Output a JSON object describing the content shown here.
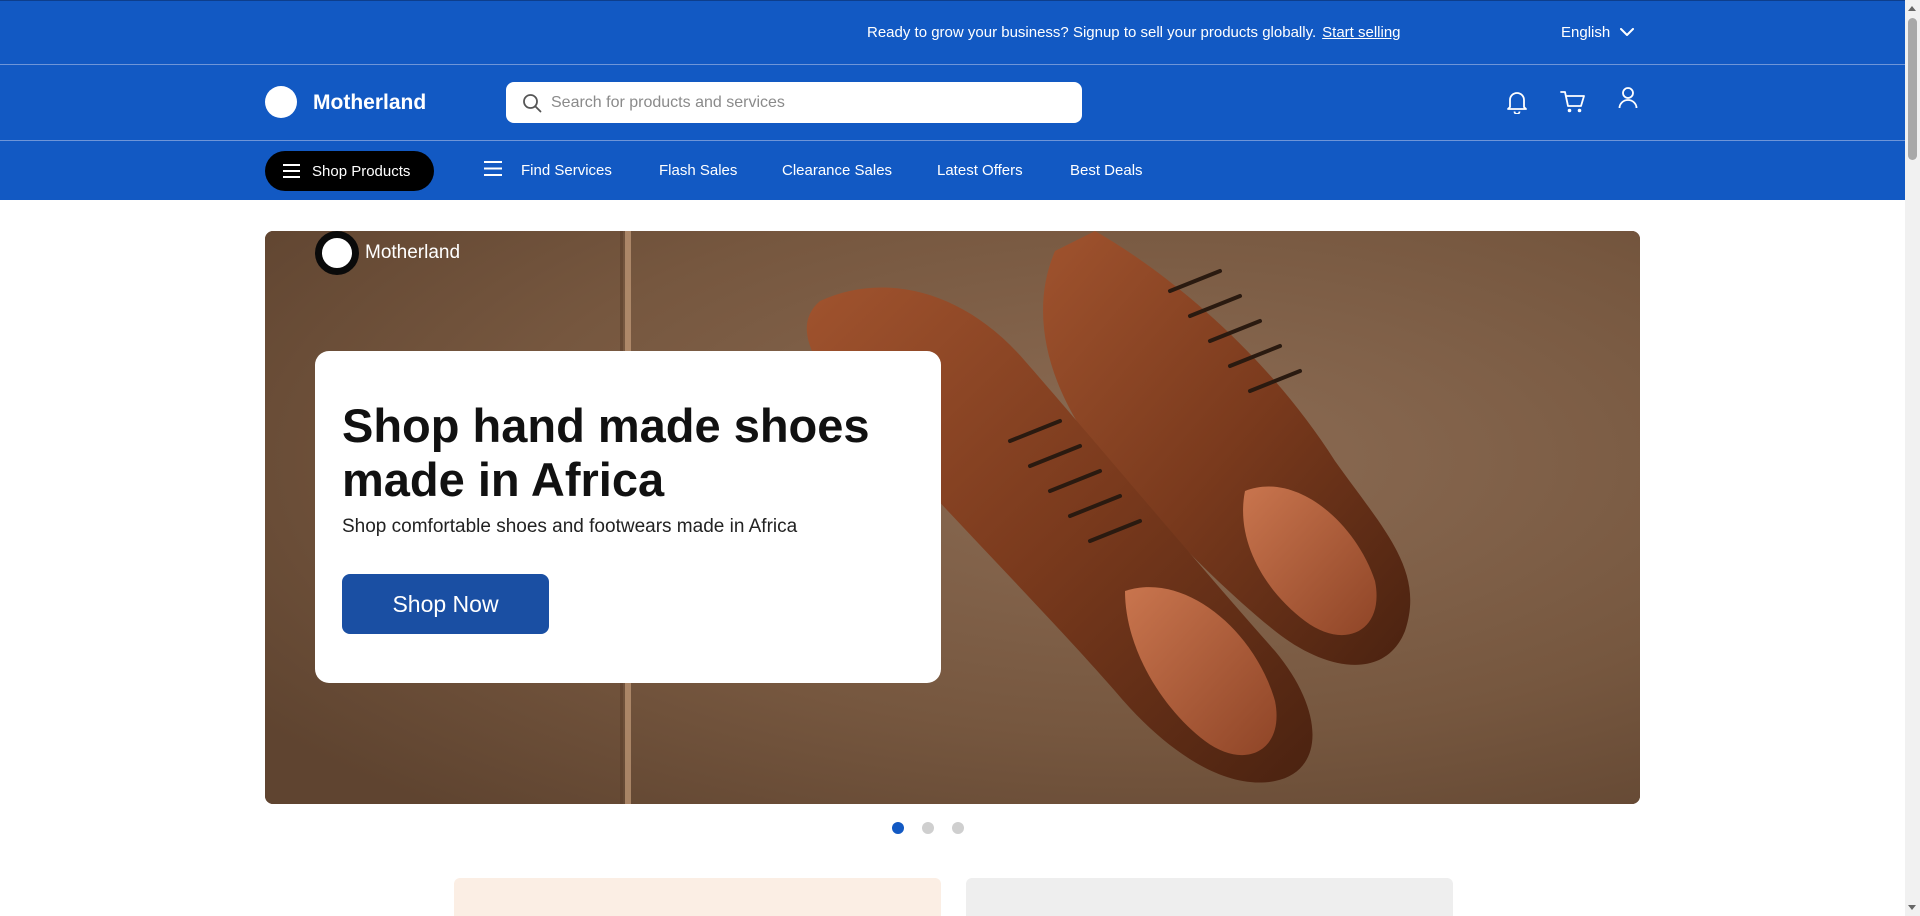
{
  "topbar": {
    "announcement": "Ready to grow your business? Signup to sell your products globally.",
    "link_label": "Start selling",
    "language": "English"
  },
  "header": {
    "brand": "Motherland",
    "search_placeholder": "Search for products and services",
    "icons": [
      "bell-icon",
      "cart-icon",
      "user-icon"
    ]
  },
  "nav": {
    "shop_products": "Shop Products",
    "items": [
      "Find Services",
      "Flash Sales",
      "Clearance Sales",
      "Latest Offers",
      "Best Deals"
    ]
  },
  "hero": {
    "brand": "Motherland",
    "title": "Shop hand made shoes made in Africa",
    "subtitle": "Shop comfortable shoes and footwears made in Africa",
    "cta": "Shop Now",
    "slide_count": 3,
    "active_slide": 1
  },
  "colors": {
    "brand_blue": "#1259c3",
    "cta_blue": "#1a4fa3",
    "promo_left": "#fbeee4",
    "promo_right": "#eeeeee"
  }
}
